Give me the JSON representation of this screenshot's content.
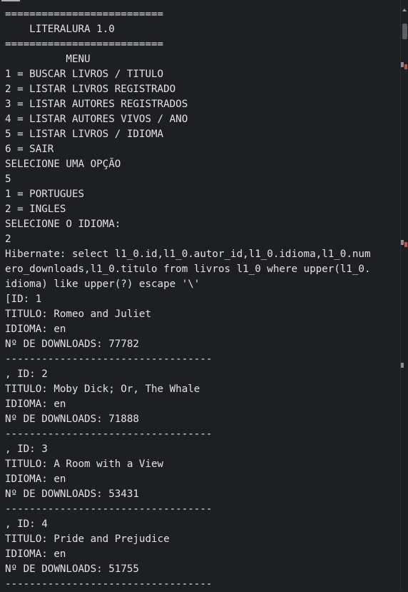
{
  "terminal": {
    "lines": [
      "==========================",
      "    LITERALURA 1.0",
      "==========================",
      "          MENU",
      "1 = BUSCAR LIVROS / TITULO",
      "2 = LISTAR LIVROS REGISTRADO",
      "3 = LISTAR AUTORES REGISTRADOS",
      "4 = LISTAR AUTORES VIVOS / ANO",
      "5 = LISTAR LIVROS / IDIOMA",
      "6 = SAIR",
      "SELECIONE UMA OPÇÃO",
      "5",
      "1 = PORTUGUES",
      "2 = INGLES",
      "SELECIONE O IDIOMA:",
      "2",
      "Hibernate: select l1_0.id,l1_0.autor_id,l1_0.idioma,l1_0.num",
      "ero_downloads,l1_0.titulo from livros l1_0 where upper(l1_0.",
      "idioma) like upper(?) escape '\\'",
      "[ID: 1",
      "TITULO: Romeo and Juliet",
      "IDIOMA: en",
      "Nº DE DOWNLOADS: 77782",
      "----------------------------------",
      ", ID: 2",
      "TITULO: Moby Dick; Or, The Whale",
      "IDIOMA: en",
      "Nº DE DOWNLOADS: 71888",
      "----------------------------------",
      ", ID: 3",
      "TITULO: A Room with a View",
      "IDIOMA: en",
      "Nº DE DOWNLOADS: 53431",
      "----------------------------------",
      ", ID: 4",
      "TITULO: Pride and Prejudice",
      "IDIOMA: en",
      "Nº DE DOWNLOADS: 51755",
      "----------------------------------"
    ]
  },
  "colors": {
    "background": "#1e1f22",
    "text": "#e3e3e3",
    "error_marker": "#c94f4f",
    "warning_marker": "#8a8c90"
  },
  "icons": {
    "scroll_up": "chevron-up-icon"
  }
}
